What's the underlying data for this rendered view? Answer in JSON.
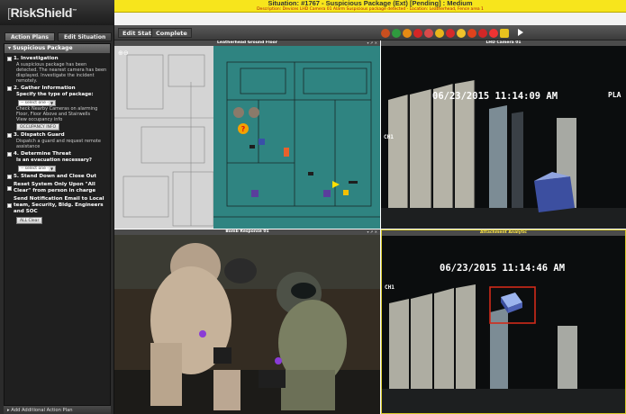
{
  "app": {
    "logo": "RiskShield"
  },
  "situation": {
    "title": "Situation: #1767 - Suspicious Package (Ext) [Pending] : Medium",
    "description": "Description: Devices LHD Camera 01 Alarm Suspicious package detected - Location: Leatherhead, Fence area 1"
  },
  "toolbar": {
    "edit_status": "Edit Status",
    "complete": "Complete"
  },
  "sidebar": {
    "tabs": [
      "Action Plans",
      "Edit Situation"
    ],
    "active_tab": "Action Plans",
    "panel_title": "Suspicious Package",
    "steps": [
      {
        "title": "1. Investigation",
        "text": "A suspicious package has been detected. The nearest camera has been displayed. Investigate the incident remotely."
      },
      {
        "title": "2. Gather Information",
        "sub": "Specify the type of package:",
        "select": "-- select one --",
        "text": "Check Nearby Cameras on alarming Floor, Floor Above and Stairwells",
        "text2": "View occupancy info",
        "button": "OCCUPANCY INFO"
      },
      {
        "title": "3. Dispatch Guard",
        "text": "Dispatch a guard and request remote assistance"
      },
      {
        "title": "4. Determine Threat",
        "sub": "Is an evacuation necessary?",
        "select": "-- select one --"
      },
      {
        "title": "5. Stand Down and Close Out"
      },
      {
        "title": "Reset System Only Upon \"All Clear\" from person in charge"
      },
      {
        "title": "Send Notification Email to Local team, Security, Bldg. Engineers and SOC",
        "button": "ALL Clear"
      }
    ],
    "add_plan": "Add Additional Action Plan"
  },
  "panes": {
    "floor": "Leatherhead Ground Floor",
    "cam1": "LHD Camera 01",
    "bomb": "Bomb Response 01",
    "attachment": "Attachment Analytic"
  },
  "camera1": {
    "timestamp": "06/23/2015 11:14:09 AM",
    "channel": "CH1",
    "overlay": "PLA"
  },
  "camera2": {
    "timestamp": "06/23/2015 11:14:46 AM",
    "channel": "CH1"
  },
  "floorplan": {
    "marker": "?"
  },
  "colors": {
    "situation_bar": "#f7e51c",
    "floor_green": "#2e7f7d",
    "detect_box": "#d12a1a"
  }
}
